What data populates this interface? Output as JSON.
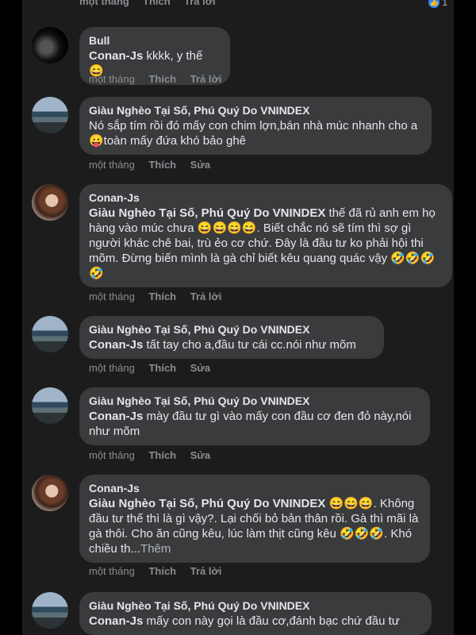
{
  "top_actions": {
    "time": "một tháng",
    "like": "Thích",
    "reply": "Trả lời",
    "reaction_count": "1"
  },
  "comments": [
    {
      "author": "Bull",
      "mention": "Conan-Js",
      "text": " kkkk, y thế 😄",
      "time": "một tháng",
      "action1": "Thích",
      "action2": "Trả lời"
    },
    {
      "author": "Giàu Nghèo Tại Số, Phú Quý Do VNINDEX",
      "mention": "",
      "text": "Nó sắp tím rồi đó mấy con chim lợn,bán nhà múc nhanh cho a 😛toàn mấy đứa khó bảo ghê",
      "time": "một tháng",
      "action1": "Thích",
      "action2": "Sửa"
    },
    {
      "author": "Conan-Js",
      "mention": "Giàu Nghèo Tại Số, Phú Quý Do VNINDEX",
      "text": " thế đã rủ anh em họ hàng vào múc chưa 😄😄😄😄. Biết chắc nó sẽ tím thì sợ gì người khác chê bai, trù ẻo cơ chứ. Đây là đầu tư ko phải hội thi mõm. Đừng biến mình là gà chỉ biết kêu quang quác vậy 🤣🤣🤣🤣",
      "time": "một tháng",
      "action1": "Thích",
      "action2": "Trả lời"
    },
    {
      "author": "Giàu Nghèo Tại Số, Phú Quý Do VNINDEX",
      "mention": "Conan-Js",
      "text": " tất tay cho a,đầu tư cái cc.nói như mõm",
      "time": "một tháng",
      "action1": "Thích",
      "action2": "Sửa"
    },
    {
      "author": "Giàu Nghèo Tại Số, Phú Quý Do VNINDEX",
      "mention": "Conan-Js",
      "text": " mày đầu tư gì vào mấy con đầu cơ đen đỏ này,nói như mõm",
      "time": "một tháng",
      "action1": "Thích",
      "action2": "Sửa"
    },
    {
      "author": "Conan-Js",
      "mention": "Giàu Nghèo Tại Số, Phú Quý Do VNINDEX",
      "text": " 😄😄😄. Không đầu tư thế thì là gì vậy?. Lại chối bỏ bản thân rồi. Gà thì mãi là gà thôi. Cho ăn cũng kêu, lúc làm thịt cũng kêu 🤣🤣🤣. Khó chiều th...",
      "see_more": "Thêm",
      "time": "một tháng",
      "action1": "Thích",
      "action2": "Trả lời"
    },
    {
      "author": "Giàu Nghèo Tại Số, Phú Quý Do VNINDEX",
      "mention": "Conan-Js",
      "text": " mấy con này gọi là đầu cơ,đánh bạc chứ đầu tư",
      "time": "",
      "action1": "",
      "action2": ""
    }
  ]
}
